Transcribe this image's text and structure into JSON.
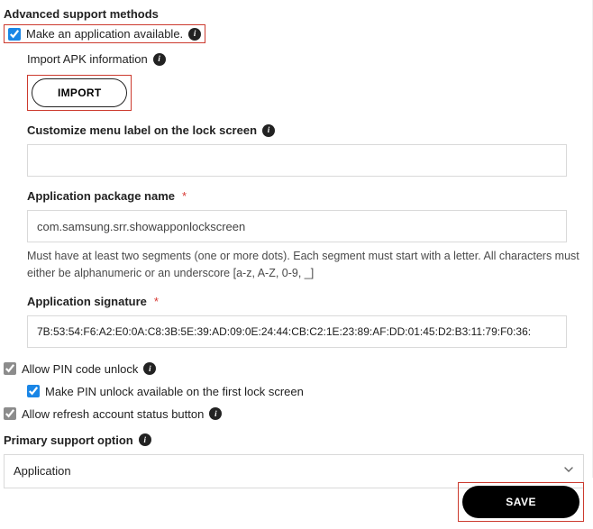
{
  "section_title": "Advanced support methods",
  "make_available": {
    "label": "Make an application available."
  },
  "import_apk": {
    "label": "Import APK information",
    "button": "IMPORT"
  },
  "customize_label": {
    "label": "Customize menu label on the lock screen",
    "value": ""
  },
  "package_name": {
    "label": "Application package name",
    "value": "com.samsung.srr.showapponlockscreen",
    "helper": "Must have at least two segments (one or more dots). Each segment must start with a letter. All characters must either be alphanumeric or an underscore [a-z, A-Z, 0-9, _]"
  },
  "signature": {
    "label": "Application signature",
    "value": "7B:53:54:F6:A2:E0:0A:C8:3B:5E:39:AD:09:0E:24:44:CB:C2:1E:23:89:AF:DD:01:45:D2:B3:11:79:F0:36:"
  },
  "allow_pin": {
    "label": "Allow PIN code unlock",
    "sub_label": "Make PIN unlock available on the first lock screen"
  },
  "allow_refresh": {
    "label": "Allow refresh account status button"
  },
  "primary_support": {
    "label": "Primary support option",
    "value": "Application"
  },
  "save_label": "SAVE"
}
